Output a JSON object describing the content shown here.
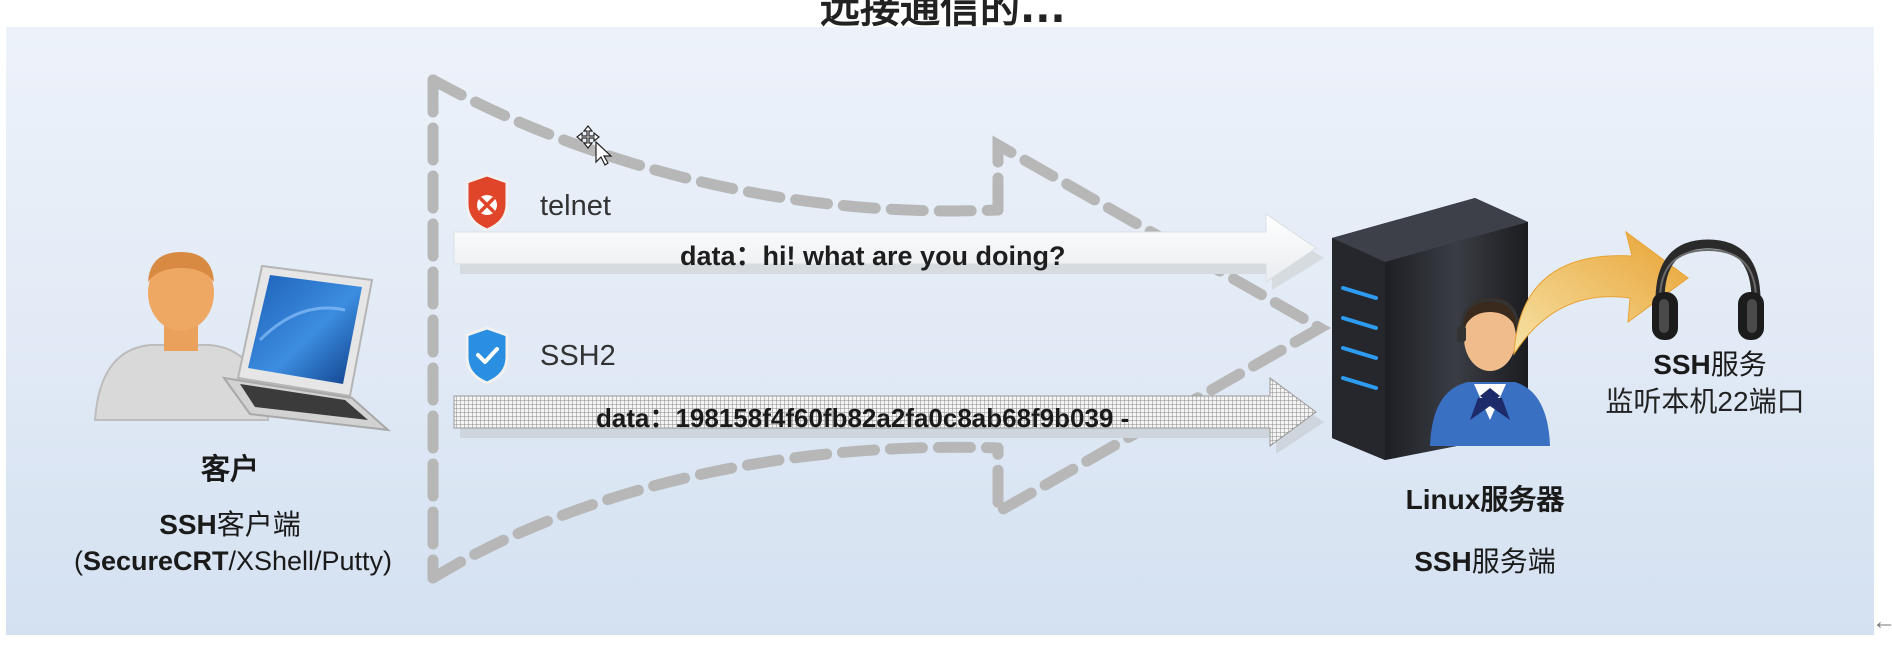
{
  "slide": {
    "title_fragment": "远接通信的...",
    "channels": {
      "telnet": {
        "label": "telnet",
        "data_text": "data：hi! what are you doing?"
      },
      "ssh2": {
        "label": "SSH2",
        "data_text": "data：198158f4f60fb82a2fa0c8ab68f9b039  -"
      }
    },
    "client": {
      "name": "客户",
      "role_bold": "SSH",
      "role_rest": "客户端",
      "apps_open": "(",
      "apps_bold": "SecureCRT",
      "apps_rest": "/XShell/Putty)"
    },
    "server": {
      "name": "Linux服务器",
      "role_bold": "SSH",
      "role_rest": "服务端"
    },
    "listener": {
      "title_bold": "SSH",
      "title_rest": "服务",
      "description": "监听本机22端口"
    },
    "icons": {
      "telnet_shield": "shield-x-icon",
      "ssh2_shield": "shield-check-icon",
      "client_person": "person-icon",
      "client_laptop": "laptop-icon",
      "server": "server-tower-icon",
      "operator": "headset-operator-icon",
      "headphones": "headphones-icon",
      "back_arrow": "back-arrow-icon"
    },
    "colors": {
      "panel_top": "#edf2fa",
      "panel_bottom": "#d4e1f1",
      "shield_red": "#e0452a",
      "shield_blue": "#2a8fe0",
      "server_body": "#2b2d33",
      "server_led": "#2d9cf0",
      "curved_arrow_gold": "#e8a233",
      "dashed_outline": "#b7b7b7"
    }
  }
}
